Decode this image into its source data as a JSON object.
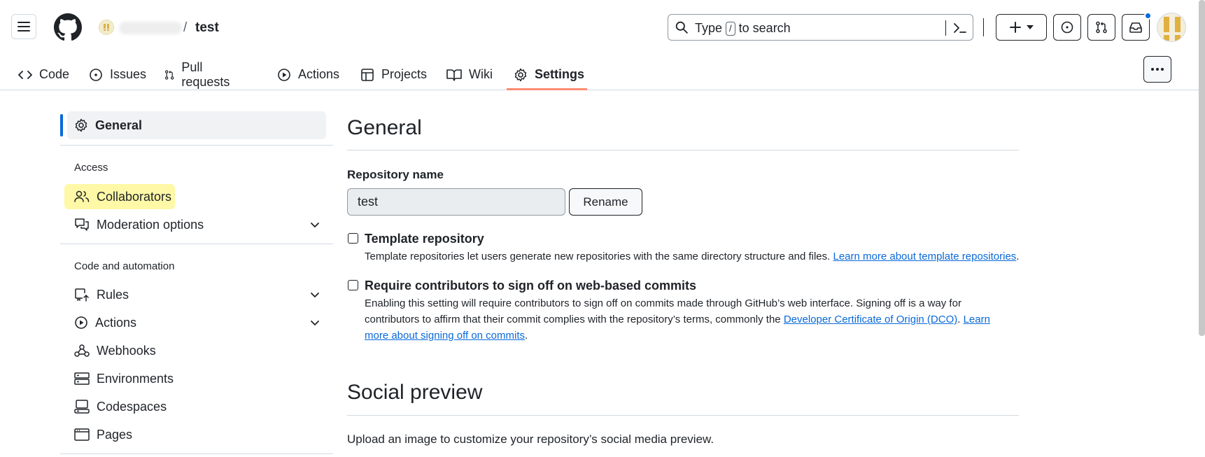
{
  "header": {
    "repo_separator": "/",
    "repo_name": "test",
    "search": {
      "prefix": "Type",
      "key": "/",
      "suffix": "to search"
    }
  },
  "tabs": [
    {
      "label": "Code",
      "icon": "code-icon"
    },
    {
      "label": "Issues",
      "icon": "issue-opened-icon"
    },
    {
      "label": "Pull requests",
      "icon": "git-pull-request-icon"
    },
    {
      "label": "Actions",
      "icon": "play-icon"
    },
    {
      "label": "Projects",
      "icon": "table-icon"
    },
    {
      "label": "Wiki",
      "icon": "book-icon"
    },
    {
      "label": "Settings",
      "icon": "gear-icon",
      "active": true
    }
  ],
  "sidebar": {
    "general": "General",
    "access_heading": "Access",
    "access_items": [
      {
        "label": "Collaborators",
        "icon": "people-icon",
        "highlighted": true
      },
      {
        "label": "Moderation options",
        "icon": "comment-discussion-icon",
        "expandable": true
      }
    ],
    "automation_heading": "Code and automation",
    "automation_items": [
      {
        "label": "Rules",
        "icon": "repo-push-icon",
        "expandable": true
      },
      {
        "label": "Actions",
        "icon": "play-icon",
        "expandable": true
      },
      {
        "label": "Webhooks",
        "icon": "webhook-icon"
      },
      {
        "label": "Environments",
        "icon": "server-icon"
      },
      {
        "label": "Codespaces",
        "icon": "codespaces-icon"
      },
      {
        "label": "Pages",
        "icon": "browser-icon"
      }
    ]
  },
  "main": {
    "title": "General",
    "repo_name_label": "Repository name",
    "repo_name_value": "test",
    "rename_label": "Rename",
    "template": {
      "title": "Template repository",
      "desc": "Template repositories let users generate new repositories with the same directory structure and files.",
      "link": "Learn more about template repositories",
      "end": "."
    },
    "signoff": {
      "title": "Require contributors to sign off on web-based commits",
      "desc1": "Enabling this setting will require contributors to sign off on commits made through GitHub’s web interface. Signing off is a way for contributors to affirm that their commit complies with the repository’s terms, commonly the",
      "link1": "Developer Certificate of Origin (DCO)",
      "mid": ".",
      "link2": "Learn more about signing off on commits",
      "end": "."
    },
    "social_title": "Social preview",
    "social_text": "Upload an image to customize your repository’s social media preview."
  },
  "colors": {
    "accent": "#0969da",
    "tab_underline": "#fd8c73",
    "highlight": "#fff8a6"
  }
}
